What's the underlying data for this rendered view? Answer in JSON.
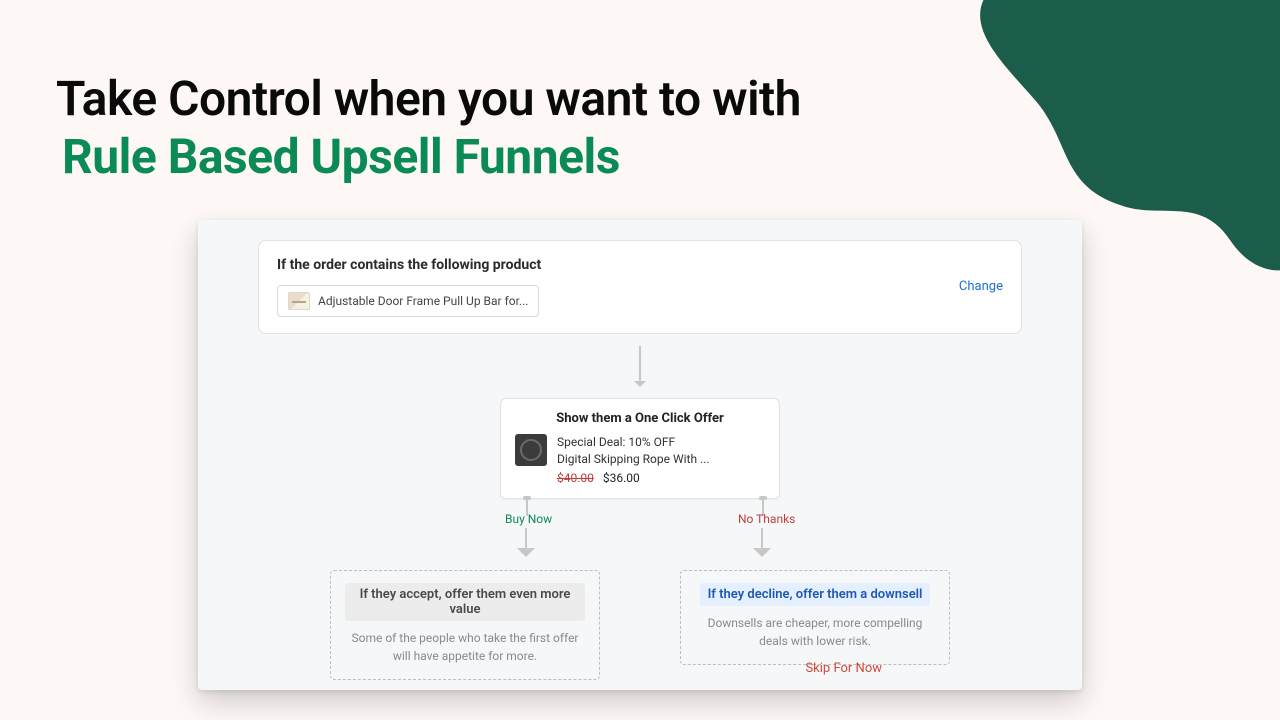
{
  "headline": {
    "line1": "Take Control when you want to with",
    "line2": "Rule Based Upsell Funnels"
  },
  "funnel": {
    "trigger": {
      "title": "If the order contains the following product",
      "product_name": "Adjustable Door Frame Pull Up Bar for...",
      "change_label": "Change"
    },
    "offer": {
      "title": "Show them a One Click Offer",
      "deal_label": "Special Deal: 10% OFF",
      "product_name": "Digital Skipping Rope With ...",
      "price_original": "$40.00",
      "price_discounted": "$36.00"
    },
    "branches": {
      "accept_label": "Buy Now",
      "decline_label": "No Thanks"
    },
    "accept_result": {
      "heading": "If they accept, offer them even more value",
      "sub": "Some of the people who take the first offer will have appetite for more."
    },
    "decline_result": {
      "heading": "If they decline, offer them a downsell",
      "sub": "Downsells are cheaper, more compelling deals with lower risk."
    },
    "skip_label": "Skip For Now"
  }
}
